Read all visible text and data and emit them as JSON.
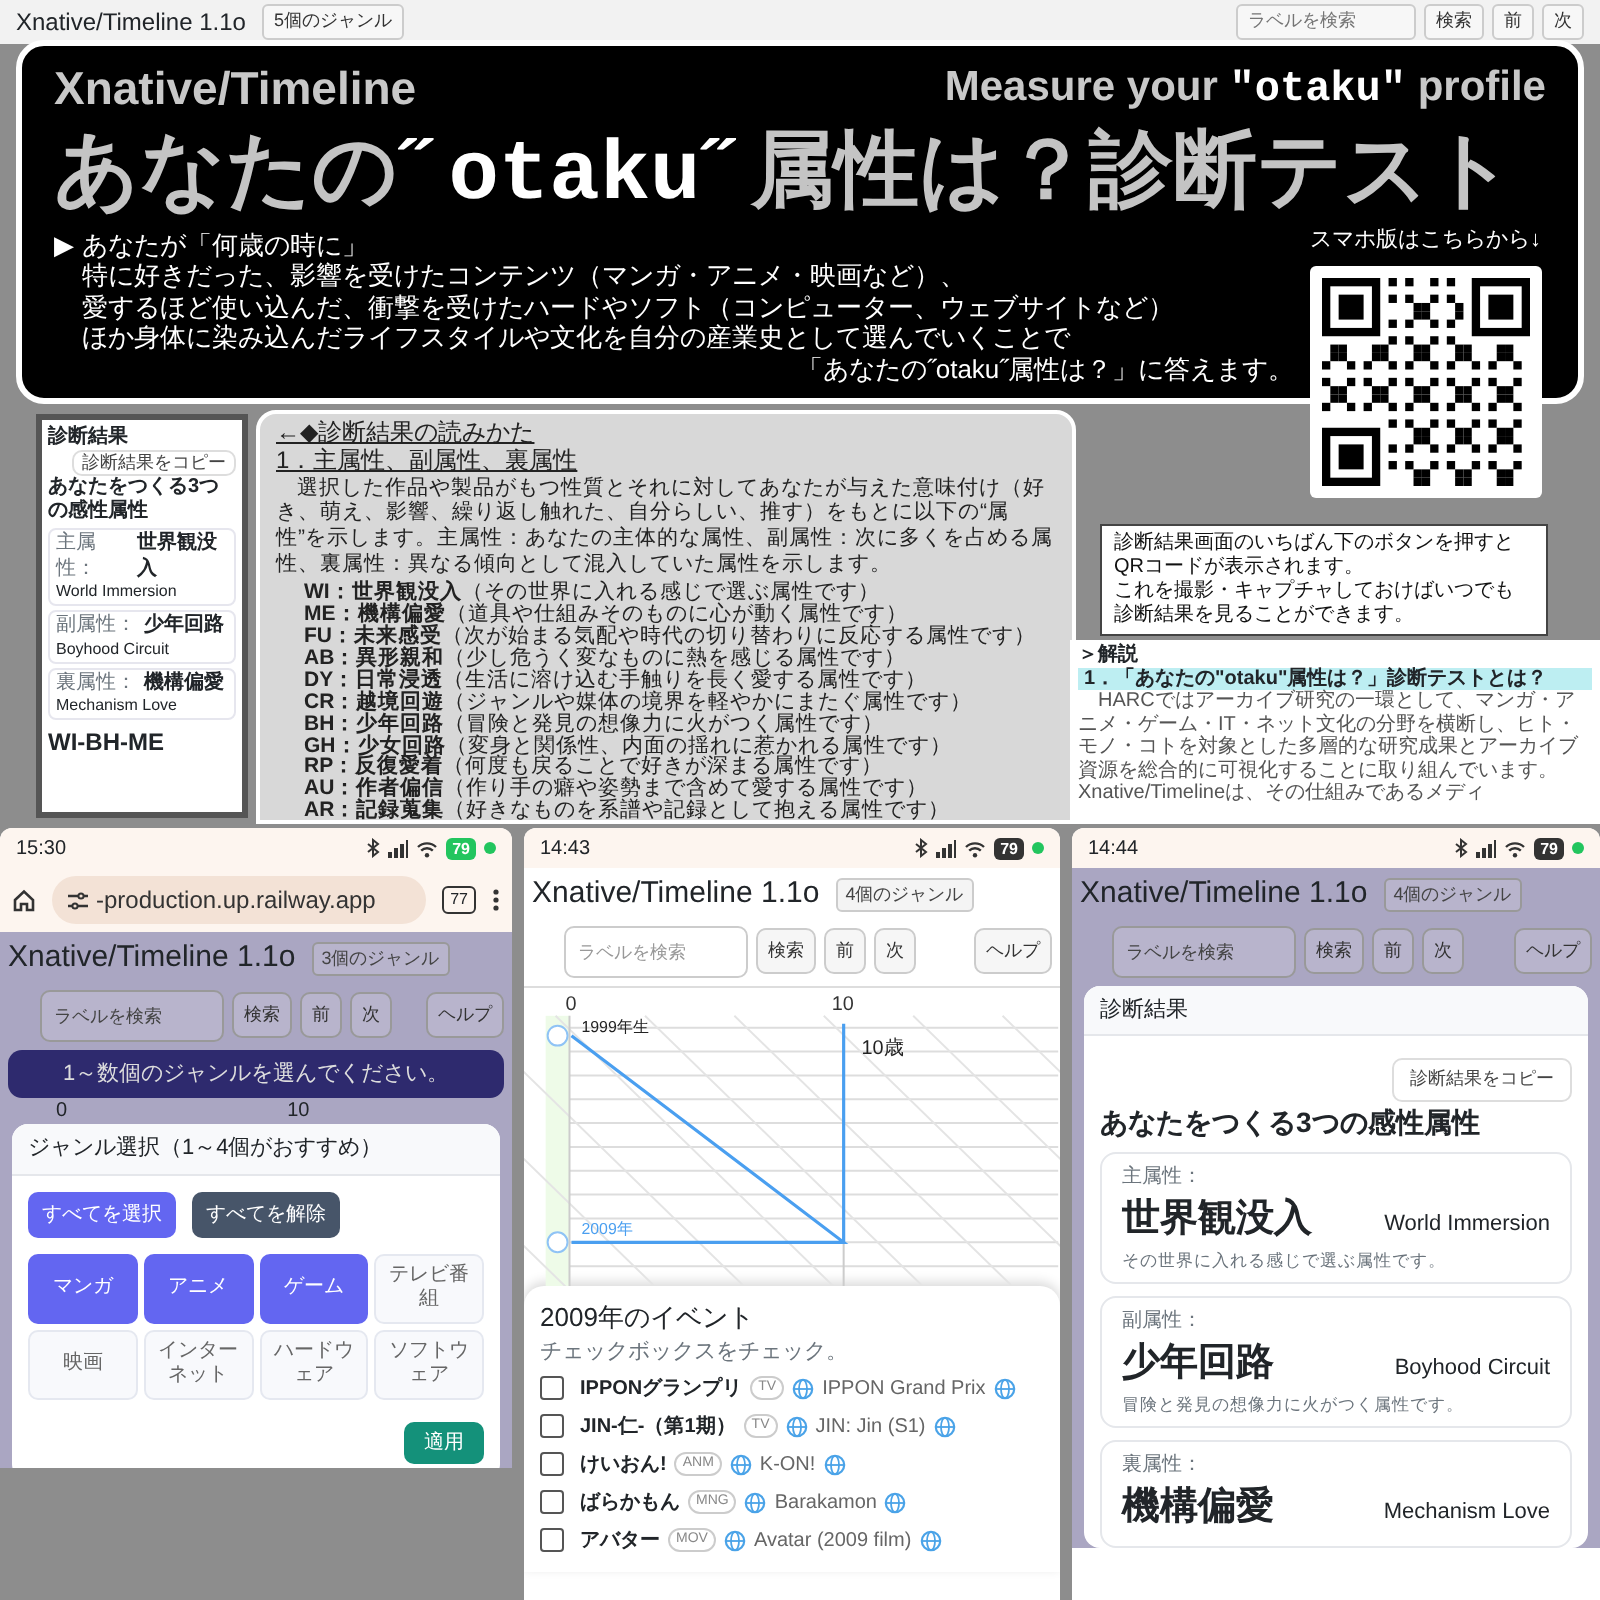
{
  "background_app": {
    "title": "Xnative/Timeline 1.1o",
    "genre_badge": "5個のジャンル",
    "search_placeholder": "ラベルを検索",
    "buttons": [
      "検索",
      "前",
      "次"
    ]
  },
  "banner": {
    "brand": "Xnative/Timeline",
    "tagline": [
      {
        "text": "Measure your ",
        "kind": "plain"
      },
      {
        "text": "\"otaku\"",
        "kind": "pixel"
      },
      {
        "text": " profile",
        "kind": "plain"
      }
    ],
    "title": [
      {
        "text": "あなたの",
        "kind": "plain"
      },
      {
        "text": "˝otaku˝",
        "kind": "pixel"
      },
      {
        "text": "属性は？診断テスト",
        "kind": "plain"
      }
    ],
    "intro_marker": "▶",
    "intro_lines": [
      "あなたが「何歳の時に」",
      "特に好きだった、影響を受けたコンテンツ（マンガ・アニメ・映画など）、",
      "愛するほど使い込んだ、衝撃を受けたハードやソフト（コンピューター、ウェブサイトなど）",
      "ほか身体に染み込んだライフスタイルや文化を自分の産業史として選んでいくことで",
      "「あなたの˝otaku˝属性は？」に答えます。"
    ],
    "qr_caption": "スマホ版はこちらから↓"
  },
  "result_thumbnail": {
    "header": "診断結果",
    "copy_button": "診断結果をコピー",
    "heading": "あなたをつくる3つの感性属性",
    "attributes": [
      {
        "label": "主属性：",
        "name": "世界観没入",
        "english": "World Immersion"
      },
      {
        "label": "副属性：",
        "name": "少年回路",
        "english": "Boyhood Circuit"
      },
      {
        "label": "裏属性：",
        "name": "機構偏愛",
        "english": "Mechanism Love"
      }
    ],
    "code": "WI-BH-ME"
  },
  "explanation": {
    "heading": "←◆診断結果の読みかた",
    "section": "1．主属性、副属性、裏属性",
    "body": "選択した作品や製品がもつ性質とそれに対してあなたが与えた意味付け（好き、萌え、影響、繰り返し触れた、自分らしい、推す）をもとに以下の“属性”を示します。主属性：あなたの主体的な属性、副属性：次に多くを占める属性、裏属性：異なる傾向として混入していた属性を示します。",
    "attributes": [
      {
        "code": "WI：",
        "name": "世界観没入",
        "desc": "（その世界に入れる感じで選ぶ属性です）"
      },
      {
        "code": "ME：",
        "name": "機構偏愛",
        "desc": "（道具や仕組みそのものに心が動く属性です）"
      },
      {
        "code": "FU：",
        "name": "未来感受",
        "desc": "（次が始まる気配や時代の切り替わりに反応する属性です）"
      },
      {
        "code": "AB：",
        "name": "異形親和",
        "desc": "（少し危うく変なものに熱を感じる属性です）"
      },
      {
        "code": "DY：",
        "name": "日常浸透",
        "desc": "（生活に溶け込む手触りを長く愛する属性です）"
      },
      {
        "code": "CR：",
        "name": "越境回遊",
        "desc": "（ジャンルや媒体の境界を軽やかにまたぐ属性です）"
      },
      {
        "code": "BH：",
        "name": "少年回路",
        "desc": "（冒険と発見の想像力に火がつく属性です）"
      },
      {
        "code": "GH：",
        "name": "少女回路",
        "desc": "（変身と関係性、内面の揺れに惹かれる属性です）"
      },
      {
        "code": "RP：",
        "name": "反復愛着",
        "desc": "（何度も戻ることで好きが深まる属性です）"
      },
      {
        "code": "AU：",
        "name": "作者偏信",
        "desc": "（作り手の癖や姿勢まで含めて愛する属性です）"
      },
      {
        "code": "AR：",
        "name": "記録蒐集",
        "desc": "（好きなものを系譜や記録として抱える属性です）"
      }
    ]
  },
  "callout": {
    "lines": [
      "診断結果画面のいちばん下のボタンを押すと",
      "QRコードが表示されます。",
      "これを撮影・キャプチャしておけばいつでも",
      "診断結果を見ることができます。"
    ]
  },
  "commentary": {
    "heading": "＞解説",
    "item": "1．「あなたの\"otaku\"属性は？」診断テストとは？",
    "body": "HARCではアーカイブ研究の一環として、マンガ・アニメ・ゲーム・IT・ネット文化の分野を横断し、ヒト・モノ・コトを対象とした多層的な研究成果とアーカイブ資源を総合的に可視化することに取り組んでいます。Xnative/Timelineは、その仕組みであるメディ"
  },
  "phones": [
    {
      "kind": "genre_picker",
      "status": {
        "time": "15:30",
        "battery": "79",
        "charging": true
      },
      "browser": {
        "url": "-production.up.railway.app",
        "tab_count": "77"
      },
      "app": {
        "title": "Xnative/Timeline 1.1o",
        "genre_badge": "3個のジャンル",
        "search_placeholder": "ラベルを検索",
        "buttons": [
          "検索",
          "前",
          "次"
        ],
        "help": "ヘルプ",
        "dimmed": true
      },
      "toast": "1～数個のジャンルを選んでください。",
      "axis_labels": [
        "0",
        "10"
      ],
      "modal": {
        "title": "ジャンル選択（1～4個がおすすめ）",
        "select_all": "すべてを選択",
        "clear_all": "すべてを解除",
        "genres": [
          {
            "label": "マンガ",
            "selected": true
          },
          {
            "label": "アニメ",
            "selected": true
          },
          {
            "label": "ゲーム",
            "selected": true
          },
          {
            "label": "テレビ番組",
            "selected": false
          },
          {
            "label": "映画",
            "selected": false
          },
          {
            "label": "インターネット",
            "selected": false
          },
          {
            "label": "ハードウェア",
            "selected": false
          },
          {
            "label": "ソフトウェア",
            "selected": false
          }
        ],
        "apply": "適用"
      }
    },
    {
      "kind": "timeline",
      "status": {
        "time": "14:43",
        "battery": "79",
        "charging": false
      },
      "app": {
        "title": "Xnative/Timeline 1.1o",
        "genre_badge": "4個のジャンル",
        "search_placeholder": "ラベルを検索",
        "buttons": [
          "検索",
          "前",
          "次"
        ],
        "help": "ヘルプ",
        "dimmed": false
      },
      "timeline": {
        "axis_labels": [
          "0",
          "10"
        ],
        "birth_label": "1999年生",
        "age_label": "10歳",
        "year_label": "2009年"
      },
      "events": {
        "title": "2009年のイベント",
        "hint": "チェックボックスをチェック。",
        "items": [
          {
            "name": "IPPONグランプリ",
            "tag": "TV",
            "english": "IPPON Grand Prix",
            "checked": false
          },
          {
            "name": "JIN-仁-（第1期）",
            "tag": "TV",
            "english": "JIN: Jin (S1)",
            "checked": false
          },
          {
            "name": "けいおん!",
            "tag": "ANM",
            "english": "K-ON!",
            "checked": false
          },
          {
            "name": "ばらかもん",
            "tag": "MNG",
            "english": "Barakamon",
            "checked": false
          },
          {
            "name": "アバター",
            "tag": "MOV",
            "english": "Avatar (2009 film)",
            "checked": false
          }
        ]
      }
    },
    {
      "kind": "result",
      "status": {
        "time": "14:44",
        "battery": "79",
        "charging": false
      },
      "app": {
        "title": "Xnative/Timeline 1.1o",
        "genre_badge": "4個のジャンル",
        "search_placeholder": "ラベルを検索",
        "buttons": [
          "検索",
          "前",
          "次"
        ],
        "help": "ヘルプ",
        "dimmed": true
      },
      "modal": {
        "title": "診断結果",
        "copy_button": "診断結果をコピー",
        "heading": "あなたをつくる3つの感性属性",
        "cards": [
          {
            "label": "主属性：",
            "name": "世界観没入",
            "english": "World Immersion",
            "desc": "その世界に入れる感じで選ぶ属性です。"
          },
          {
            "label": "副属性：",
            "name": "少年回路",
            "english": "Boyhood Circuit",
            "desc": "冒険と発見の想像力に火がつく属性です。"
          },
          {
            "label": "裏属性：",
            "name": "機構偏愛",
            "english": "Mechanism Love"
          }
        ]
      }
    }
  ]
}
